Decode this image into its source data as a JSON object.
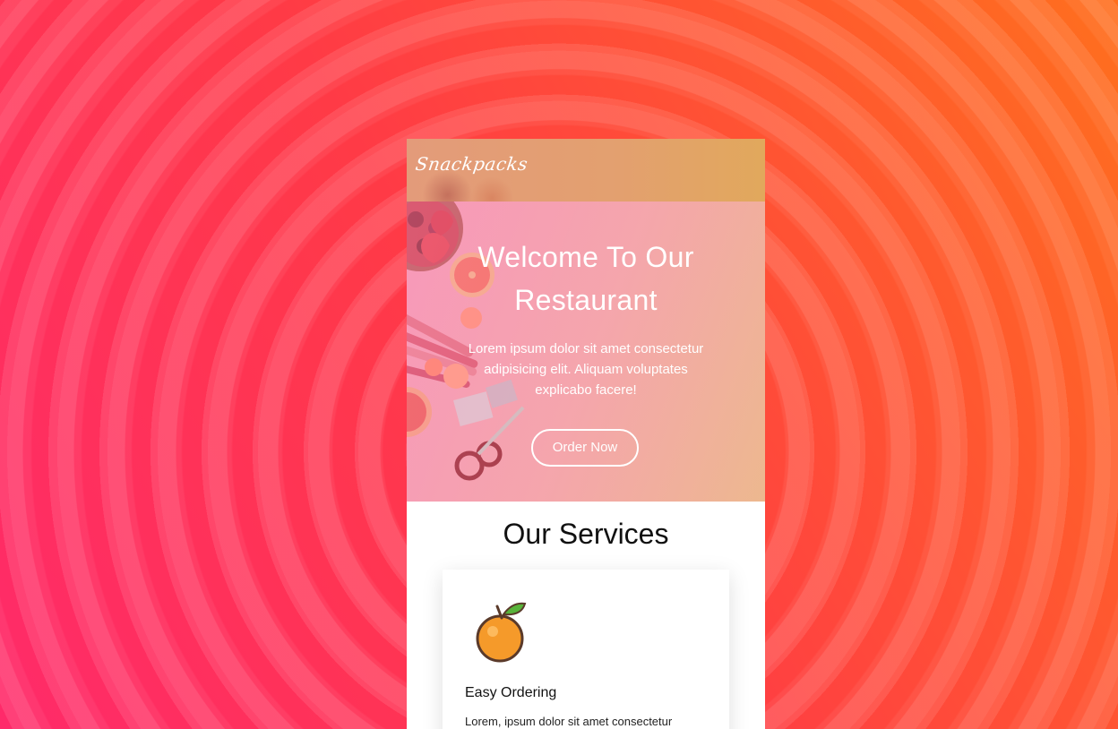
{
  "brand": {
    "logo": "Snackpacks"
  },
  "hero": {
    "title": "Welcome To Our Restaurant",
    "text": "Lorem ipsum dolor sit amet consectetur adipisicing elit. Aliquam voluptates explicabo facere!",
    "cta_label": "Order Now"
  },
  "services": {
    "title": "Our Services",
    "cards": [
      {
        "icon": "orange-icon",
        "title": "Easy Ordering",
        "text": "Lorem, ipsum dolor sit amet consectetur"
      }
    ]
  },
  "colors": {
    "background_start": "#ff2a6a",
    "background_end": "#ff6f1e",
    "header": "#e3a06f",
    "hero_overlay": "#f39ab8"
  }
}
